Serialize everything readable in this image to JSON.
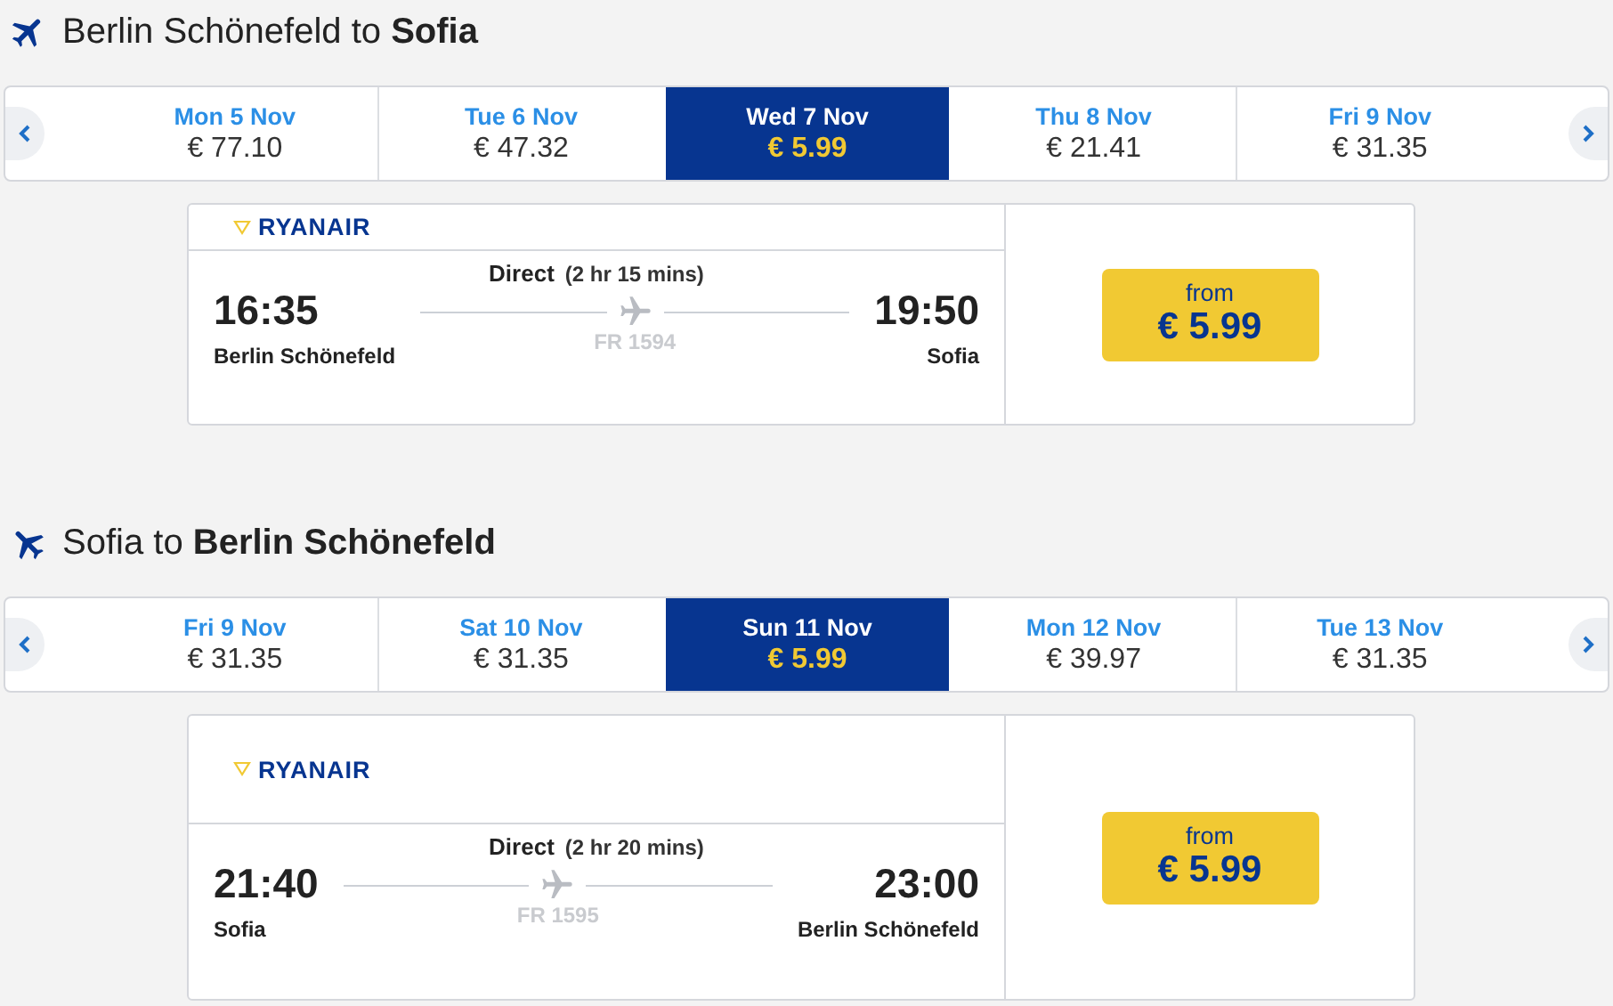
{
  "legs": [
    {
      "heading": "Berlin Schönefeld to **Sofia**",
      "kind": "outbound",
      "dates": [
        {
          "day": "Mon 5 Nov",
          "price": "€ 77.10",
          "selected": false
        },
        {
          "day": "Tue 6 Nov",
          "price": "€ 47.32",
          "selected": false
        },
        {
          "day": "Wed 7 Nov",
          "price": "€ 5.99",
          "selected": true
        },
        {
          "day": "Thu 8 Nov",
          "price": "€ 21.41",
          "selected": false
        },
        {
          "day": "Fri 9 Nov",
          "price": "€ 31.35",
          "selected": false
        }
      ],
      "flight": {
        "airline": "RYANAIR",
        "stops": "Direct",
        "duration": "(2 hr 15 mins)",
        "depart_time": "16:35",
        "depart_airport": "Berlin Schönefeld",
        "arrive_time": "19:50",
        "arrive_airport": "Sofia",
        "flight_number": "FR 1594",
        "price_label": "from",
        "price": "€ 5.99"
      }
    },
    {
      "heading": "Sofia to **Berlin Schönefeld**",
      "kind": "return",
      "dates": [
        {
          "day": "Fri 9 Nov",
          "price": "€ 31.35",
          "selected": false
        },
        {
          "day": "Sat 10 Nov",
          "price": "€ 31.35",
          "selected": false
        },
        {
          "day": "Sun 11 Nov",
          "price": "€ 5.99",
          "selected": true
        },
        {
          "day": "Mon 12 Nov",
          "price": "€ 39.97",
          "selected": false
        },
        {
          "day": "Tue 13 Nov",
          "price": "€ 31.35",
          "selected": false
        }
      ],
      "flight": {
        "airline": "RYANAIR",
        "stops": "Direct",
        "duration": "(2 hr 20 mins)",
        "depart_time": "21:40",
        "depart_airport": "Sofia",
        "arrive_time": "23:00",
        "arrive_airport": "Berlin Schönefeld",
        "flight_number": "FR 1595",
        "price_label": "from",
        "price": "€ 5.99"
      }
    }
  ]
}
